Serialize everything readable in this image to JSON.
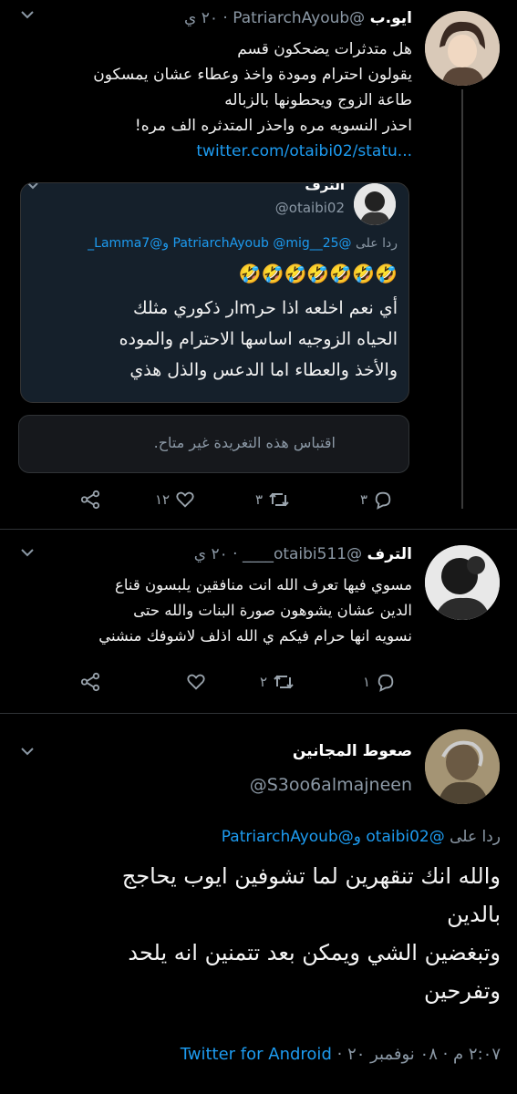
{
  "tweet1": {
    "name": "ايو.ب",
    "handle": "@PatriarchAyoub",
    "time": "٢٠ ي",
    "lines": [
      "هل متدثرات يضحكون قسم",
      "يقولون احترام ومودة واخذ وعطاء عشان يمسكون",
      "طاعة الزوج ويحطونها بالزباله",
      "احذر النسويه مره واحذر المتدثره الف مره!"
    ],
    "link": "twitter.com/otaibi02/statu..."
  },
  "quote": {
    "name": "الترف",
    "handle": "@otaibi02",
    "reply_prefix": "ردا على",
    "reply_to": "@PatriarchAyoub @mig__25 و@Lamma7_",
    "emojis": "🤣🤣🤣🤣🤣🤣🤣",
    "lines": [
      "أي نعم اخلعه اذا حرmار ذكوري مثلك",
      "الحياه الزوجيه اساسها الاحترام والموده",
      "والأخذ والعطاء اما الدعس والذل هذي"
    ]
  },
  "unavailable_text": "اقتباس هذه التغريدة غير متاح.",
  "tweet1_actions": {
    "replies": "٣",
    "retweets": "٣",
    "likes": "١٢"
  },
  "tweet2": {
    "name": "الترف",
    "handle": "@otaibi511____",
    "time": "٢٠ ي",
    "lines": [
      "مسوي فيها تعرف الله انت منافقين يلبسون قناع",
      "الدين عشان يشوهون صورة البنات والله حتى",
      "نسويه انها حرام فيكم ي الله اذلف لاشوفك منشني"
    ]
  },
  "tweet2_actions": {
    "replies": "١",
    "retweets": "٢",
    "likes": ""
  },
  "tweet3": {
    "name": "صعوط المجانين",
    "handle": "@S3oo6almajneen",
    "reply_prefix": "ردا على",
    "reply_to": "@otaibi02 و@PatriarchAyoub",
    "lines": [
      "والله انك تنقهرين لما تشوفين ايوب يحاجج",
      "بالدين",
      "وتبغضين الشي ويمكن بعد تتمنين انه يلحد",
      "وتفرحين"
    ],
    "meta_time": "٢:٠٧ م · ٠٨ نوفمبر ٢٠",
    "meta_source": "Twitter for Android"
  },
  "colors": {
    "link": "#1d9bf0",
    "background": "#000000",
    "muted": "#8b98a5"
  }
}
